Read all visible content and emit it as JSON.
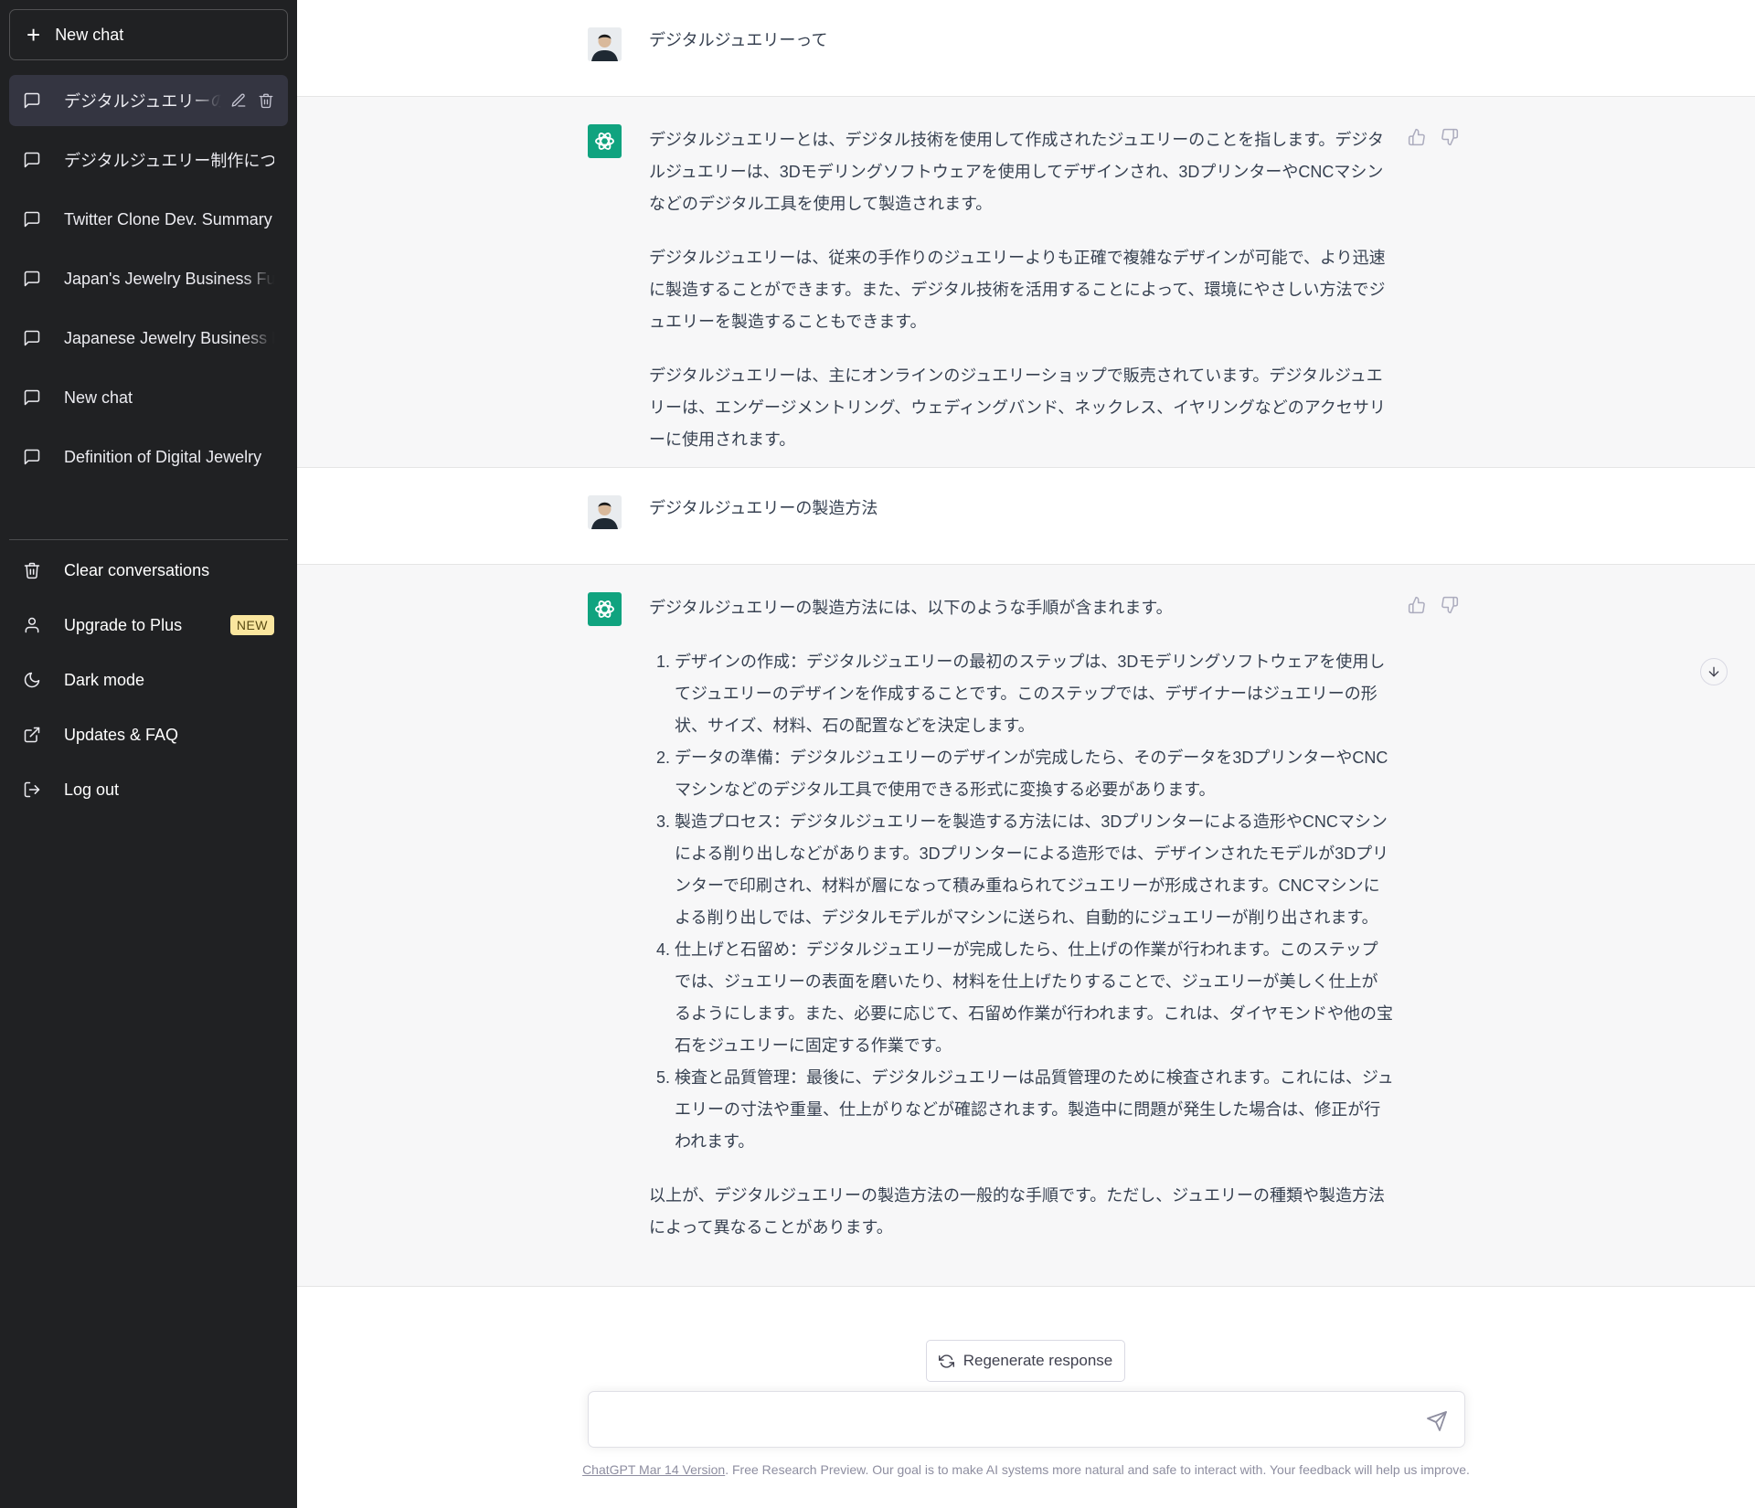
{
  "sidebar": {
    "new_chat_label": "New chat",
    "conversations": [
      {
        "label": "デジタルジュエリーの製造方法"
      },
      {
        "label": "デジタルジュエリー制作について"
      },
      {
        "label": "Twitter Clone Dev. Summary"
      },
      {
        "label": "Japan's Jewelry Business Future"
      },
      {
        "label": "Japanese Jewelry Business Future"
      },
      {
        "label": "New chat"
      },
      {
        "label": "Definition of Digital Jewelry"
      }
    ],
    "menu": {
      "clear": "Clear conversations",
      "upgrade": "Upgrade to Plus",
      "upgrade_badge": "NEW",
      "dark_mode": "Dark mode",
      "updates": "Updates & FAQ",
      "logout": "Log out"
    }
  },
  "thread": {
    "user1": "デジタルジュエリーって",
    "bot1": [
      "デジタルジュエリーとは、デジタル技術を使用して作成されたジュエリーのことを指します。デジタルジュエリーは、3Dモデリングソフトウェアを使用してデザインされ、3DプリンターやCNCマシンなどのデジタル工具を使用して製造されます。",
      "デジタルジュエリーは、従来の手作りのジュエリーよりも正確で複雑なデザインが可能で、より迅速に製造することができます。また、デジタル技術を活用することによって、環境にやさしい方法でジュエリーを製造することもできます。",
      "デジタルジュエリーは、主にオンラインのジュエリーショップで販売されています。デジタルジュエリーは、エンゲージメントリング、ウェディングバンド、ネックレス、イヤリングなどのアクセサリーに使用されます。"
    ],
    "user2": "デジタルジュエリーの製造方法",
    "bot2": {
      "intro": "デジタルジュエリーの製造方法には、以下のような手順が含まれます。",
      "steps": [
        "デザインの作成：デジタルジュエリーの最初のステップは、3Dモデリングソフトウェアを使用してジュエリーのデザインを作成することです。このステップでは、デザイナーはジュエリーの形状、サイズ、材料、石の配置などを決定します。",
        "データの準備：デジタルジュエリーのデザインが完成したら、そのデータを3DプリンターやCNCマシンなどのデジタル工具で使用できる形式に変換する必要があります。",
        "製造プロセス：デジタルジュエリーを製造する方法には、3Dプリンターによる造形やCNCマシンによる削り出しなどがあります。3Dプリンターによる造形では、デザインされたモデルが3Dプリンターで印刷され、材料が層になって積み重ねられてジュエリーが形成されます。CNCマシンによる削り出しでは、デジタルモデルがマシンに送られ、自動的にジュエリーが削り出されます。",
        "仕上げと石留め：デジタルジュエリーが完成したら、仕上げの作業が行われます。このステップでは、ジュエリーの表面を磨いたり、材料を仕上げたりすることで、ジュエリーが美しく仕上がるようにします。また、必要に応じて、石留め作業が行われます。これは、ダイヤモンドや他の宝石をジュエリーに固定する作業です。",
        "検査と品質管理：最後に、デジタルジュエリーは品質管理のために検査されます。これには、ジュエリーの寸法や重量、仕上がりなどが確認されます。製造中に問題が発生した場合は、修正が行われます。"
      ],
      "outro": "以上が、デジタルジュエリーの製造方法の一般的な手順です。ただし、ジュエリーの種類や製造方法によって異なることがあります。"
    }
  },
  "composer": {
    "regenerate_label": "Regenerate response",
    "input_value": "",
    "footer_link": "ChatGPT Mar 14 Version",
    "footer_text": ". Free Research Preview. Our goal is to make AI systems more natural and safe to interact with. Your feedback will help us improve."
  },
  "colors": {
    "sidebar_bg": "#202123",
    "active_item_bg": "#343541",
    "bot_avatar": "#10a37f",
    "bot_row_bg": "#f7f7f8",
    "badge_bg": "#fae69e"
  }
}
